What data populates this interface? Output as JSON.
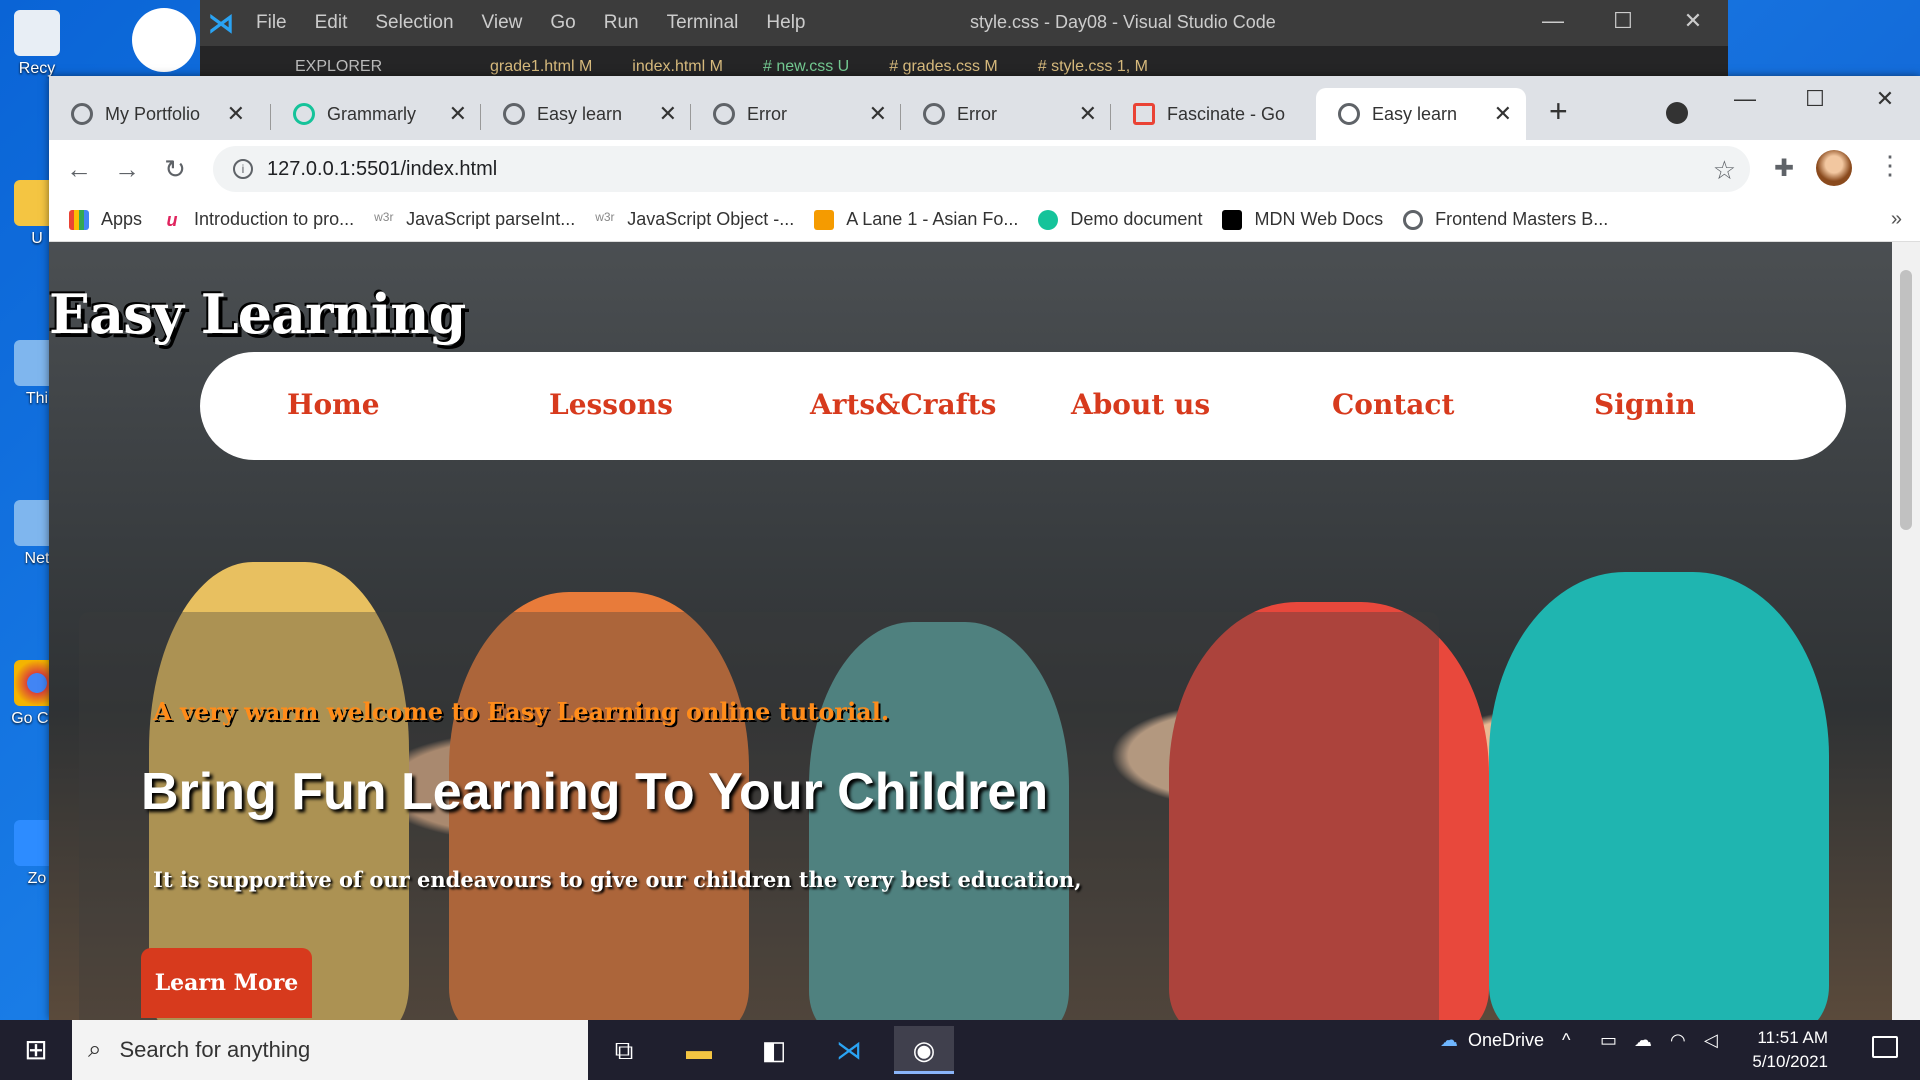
{
  "desktop": {
    "icons": [
      "Recy",
      "U",
      "Thi",
      "Net",
      "Go\nChr",
      "Zo"
    ]
  },
  "vscode": {
    "menu": [
      "File",
      "Edit",
      "Selection",
      "View",
      "Go",
      "Run",
      "Terminal",
      "Help"
    ],
    "title": "style.css - Day08 - Visual Studio Code",
    "explorer": "EXPLORER",
    "tabs": [
      "grade1.html M",
      "index.html M",
      "# new.css U",
      "# grades.css M",
      "# style.css 1, M"
    ]
  },
  "chrome": {
    "tabs": [
      {
        "label": "My Portfolio"
      },
      {
        "label": "Grammarly"
      },
      {
        "label": "Easy learn"
      },
      {
        "label": "Error"
      },
      {
        "label": "Error"
      },
      {
        "label": "Fascinate - Go"
      },
      {
        "label": "Easy learn"
      }
    ],
    "url": "127.0.0.1:5501/index.html",
    "bookmarks": [
      {
        "label": "Apps"
      },
      {
        "label": "Introduction to pro..."
      },
      {
        "label": "JavaScript parseInt..."
      },
      {
        "label": "JavaScript Object -..."
      },
      {
        "label": "A Lane 1 - Asian Fo..."
      },
      {
        "label": "Demo document"
      },
      {
        "label": "MDN Web Docs"
      },
      {
        "label": "Frontend Masters B..."
      }
    ],
    "bookmark_more": "»"
  },
  "page": {
    "logo": "Easy Learning",
    "nav": [
      "Home",
      "Lessons",
      "Arts&Crafts",
      "About us",
      "Contact",
      "Signin"
    ],
    "welcome": "A very warm welcome to Easy Learning online tutorial.",
    "headline": "Bring Fun Learning To Your Children",
    "subline": "It is supportive of our endeavours to give our children the very best education,",
    "cta": "Learn More",
    "accent_color": "#d73a1d"
  },
  "taskbar": {
    "search_placeholder": "Search for anything",
    "onedrive": "OneDrive",
    "time": "11:51 AM",
    "date": "5/10/2021"
  }
}
